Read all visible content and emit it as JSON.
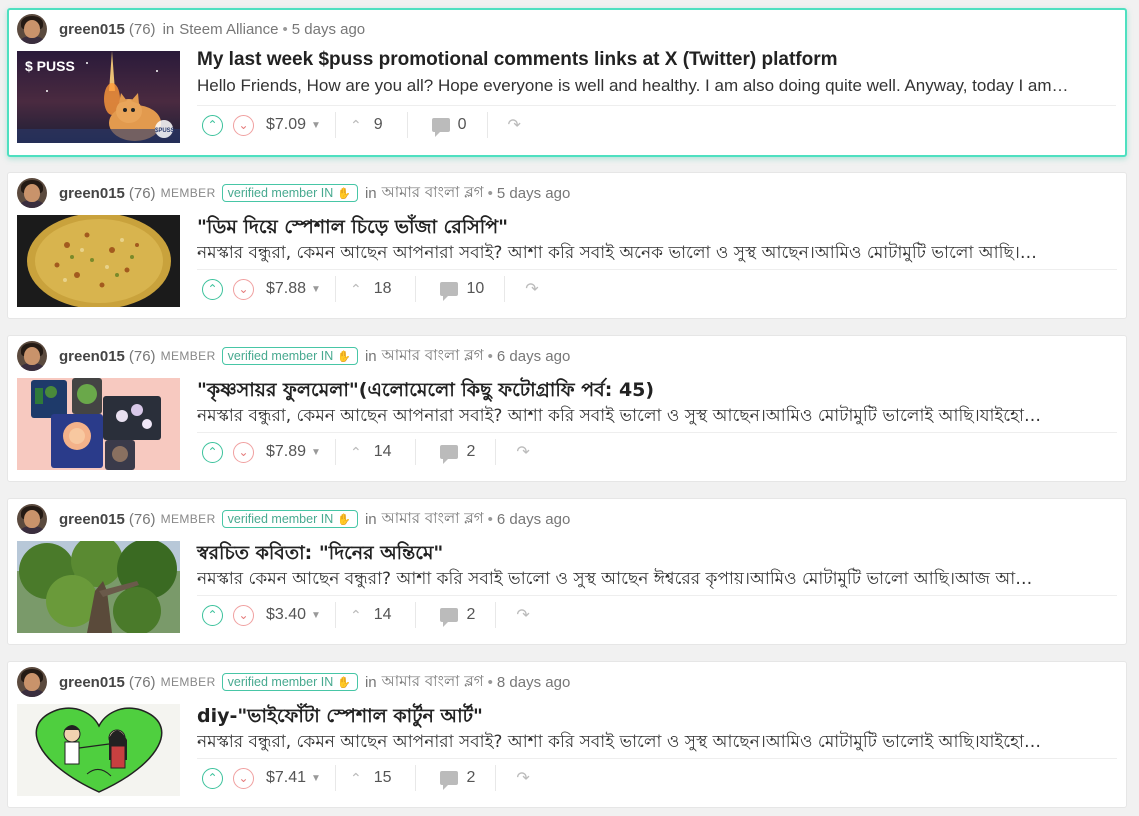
{
  "posts": [
    {
      "author": "green015",
      "rep": "(76)",
      "member_label": "",
      "verified_label": "",
      "in_label": "in",
      "community": "Steem Alliance",
      "time": "5 days ago",
      "title": "My last week $puss promotional comments links at X (Twitter) platform",
      "summary": "Hello Friends, How are you all? Hope everyone is well and healthy. I am also doing quite well. Anyway, today I am…",
      "payout": "$7.09",
      "votes": "9",
      "comments": "0",
      "thumb_text": "$ PUSS",
      "thumb_logo": "$PUSS"
    },
    {
      "author": "green015",
      "rep": "(76)",
      "member_label": "MEMBER",
      "verified_label": "verified member IN",
      "in_label": "in",
      "community": "আমার বাংলা ব্লগ",
      "time": "5 days ago",
      "title": "\"ডিম দিয়ে স্পেশাল চিড়ে ভাঁজা রেসিপি\"",
      "summary": "নমস্কার বন্ধুরা, কেমন আছেন আপনারা সবাই? আশা করি সবাই অনেক ভালো ও সুস্থ আছেন।আমিও মোটামুটি ভালো আছি।…",
      "payout": "$7.88",
      "votes": "18",
      "comments": "10"
    },
    {
      "author": "green015",
      "rep": "(76)",
      "member_label": "MEMBER",
      "verified_label": "verified member IN",
      "in_label": "in",
      "community": "আমার বাংলা ব্লগ",
      "time": "6 days ago",
      "title": "\"কৃষ্ণসায়র ফুলমেলা\"(এলোমেলো কিছু ফটোগ্রাফি পর্ব: 45)",
      "summary": "নমস্কার বন্ধুরা, কেমন আছেন আপনারা সবাই? আশা করি সবাই ভালো ও সুস্থ আছেন।আমিও মোটামুটি ভালোই আছি।যাইহো…",
      "payout": "$7.89",
      "votes": "14",
      "comments": "2"
    },
    {
      "author": "green015",
      "rep": "(76)",
      "member_label": "MEMBER",
      "verified_label": "verified member IN",
      "in_label": "in",
      "community": "আমার বাংলা ব্লগ",
      "time": "6 days ago",
      "title": "স্বরচিত কবিতা: \"দিনের অন্তিমে\"",
      "summary": "নমস্কার কেমন আছেন বন্ধুরা? আশা করি সবাই ভালো ও সুস্থ আছেন ঈশ্বরের কৃপায়।আমিও মোটামুটি ভালো আছি।আজ আ…",
      "payout": "$3.40",
      "votes": "14",
      "comments": "2"
    },
    {
      "author": "green015",
      "rep": "(76)",
      "member_label": "MEMBER",
      "verified_label": "verified member IN",
      "in_label": "in",
      "community": "আমার বাংলা ব্লগ",
      "time": "8 days ago",
      "title": "diy-\"ভাইফোঁটা স্পেশাল কার্টুন আর্ট\"",
      "summary": "নমস্কার বন্ধুরা, কেমন আছেন আপনারা সবাই? আশা করি সবাই ভালো ও সুস্থ আছেন।আমিও মোটামুটি ভালোই আছি।যাইহো…",
      "payout": "$7.41",
      "votes": "15",
      "comments": "2"
    }
  ],
  "colors": {
    "accent": "#3cc29c",
    "highlight_border": "#4ee0c0",
    "downvote": "#e57b7b"
  },
  "icons": {
    "upvote": "chevron-up-circle-icon",
    "downvote": "chevron-down-circle-icon",
    "votes": "chevron-up-icon",
    "comments": "speech-bubble-icon",
    "reblog": "reblog-icon"
  }
}
